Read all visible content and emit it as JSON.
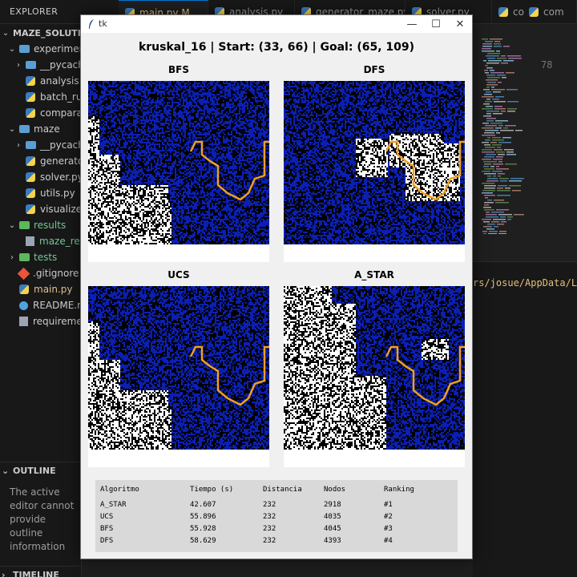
{
  "vscode": {
    "explorer_title": "EXPLORER",
    "tabs": [
      {
        "label": "main.py M",
        "active": true
      },
      {
        "label": "analysis.py",
        "active": false
      },
      {
        "label": "generator_maze.py",
        "active": false
      },
      {
        "label": "solver.py",
        "active": false
      },
      {
        "label": "co",
        "active": false
      }
    ],
    "tree": [
      {
        "label": "MAZE_SOLUTIONS",
        "kind": "root",
        "depth": 0,
        "chev": "⌄"
      },
      {
        "label": "experiments",
        "kind": "folder",
        "depth": 1,
        "chev": "⌄"
      },
      {
        "label": "__pycache__",
        "kind": "folder",
        "depth": 2,
        "chev": "›"
      },
      {
        "label": "analysis.py",
        "kind": "py",
        "depth": 2,
        "chev": ""
      },
      {
        "label": "batch_run",
        "kind": "py",
        "depth": 2,
        "chev": ""
      },
      {
        "label": "comparat",
        "kind": "py",
        "depth": 2,
        "chev": ""
      },
      {
        "label": "maze",
        "kind": "folder",
        "depth": 1,
        "chev": "⌄"
      },
      {
        "label": "__pycache__",
        "kind": "folder",
        "depth": 2,
        "chev": "›"
      },
      {
        "label": "generator",
        "kind": "py",
        "depth": 2,
        "chev": ""
      },
      {
        "label": "solver.py",
        "kind": "py",
        "depth": 2,
        "chev": ""
      },
      {
        "label": "utils.py",
        "kind": "py",
        "depth": 2,
        "chev": ""
      },
      {
        "label": "visualizer",
        "kind": "py",
        "depth": 2,
        "chev": ""
      },
      {
        "label": "results",
        "kind": "folder-green",
        "depth": 1,
        "chev": "⌄"
      },
      {
        "label": "maze_res",
        "kind": "txt",
        "depth": 2,
        "chev": ""
      },
      {
        "label": "tests",
        "kind": "folder-green",
        "depth": 1,
        "chev": "›"
      },
      {
        "label": ".gitignore",
        "kind": "git",
        "depth": 1,
        "chev": ""
      },
      {
        "label": "main.py",
        "kind": "py",
        "depth": 1,
        "chev": ""
      },
      {
        "label": "README.m",
        "kind": "info",
        "depth": 1,
        "chev": ""
      },
      {
        "label": "requiremen",
        "kind": "txt",
        "depth": 1,
        "chev": ""
      }
    ],
    "outline_header": "OUTLINE",
    "outline_message": "The active editor cannot provide outline information",
    "timeline_header": "TIMELINE",
    "right_tab_label": "com",
    "line_number": "78",
    "terminal_path": "rs/josue/AppData/Lo"
  },
  "tk": {
    "window_title": "tk",
    "heading": "kruskal_16 | Start: (33, 66) | Goal: (65, 109)",
    "panels": [
      {
        "label": "BFS",
        "explored": "bfs"
      },
      {
        "label": "DFS",
        "explored": "dfs"
      },
      {
        "label": "UCS",
        "explored": "bfs"
      },
      {
        "label": "A_STAR",
        "explored": "astar"
      }
    ],
    "colors": {
      "wall": "#0b1fb0",
      "passage": "#000000",
      "explored": "#ffffff",
      "path": "#f0a020"
    },
    "results": {
      "headers": [
        "Algoritmo",
        "Tiempo (s)",
        "Distancia",
        "Nodos",
        "Ranking"
      ],
      "rows": [
        [
          "A_STAR",
          "42.607",
          "232",
          "2918",
          "#1"
        ],
        [
          "UCS",
          "55.896",
          "232",
          "4035",
          "#2"
        ],
        [
          "BFS",
          "55.928",
          "232",
          "4045",
          "#3"
        ],
        [
          "DFS",
          "58.629",
          "232",
          "4393",
          "#4"
        ]
      ]
    }
  }
}
